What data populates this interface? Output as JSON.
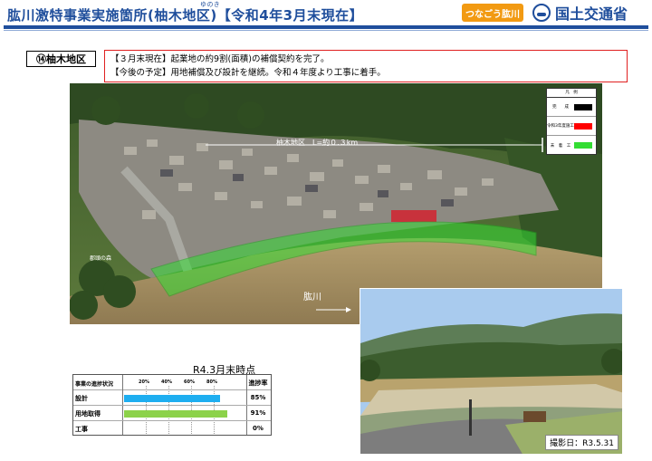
{
  "header": {
    "title": "肱川激特事業実施箇所(柚木地区)【令和4年3月末現在】",
    "ruby": "ゆのき",
    "badge": "つなごう肱川",
    "ministry": "国土交通省"
  },
  "area_label": "⑭柚木地区",
  "status": {
    "line1": "【３月末現在】起業地の約9割(面積)の補償契約を完了。",
    "line2": "【今後の予定】用地補償及び設計を継続。令和４年度より工事に着手。"
  },
  "photo": {
    "district_label": "柚木地区　L=約０.３km",
    "river_label": "肱川",
    "place_label": "郡頭の森",
    "date_label": "撮影日：R3.5.31"
  },
  "legend": {
    "heading": "凡　例",
    "items": [
      {
        "label": "完　　成",
        "color": "#000000"
      },
      {
        "label": "令和3年度施工",
        "color": "#ff0000"
      },
      {
        "label": "未　着　工",
        "color": "#33dd33"
      }
    ]
  },
  "progress": {
    "title": "R4.3月末時点",
    "header_label": "事業の進捗状況",
    "rate_label": "進捗率",
    "ticks": [
      "20%",
      "40%",
      "60%",
      "80%"
    ],
    "rows": [
      {
        "label": "設計",
        "value": 85,
        "pct": "85%",
        "color": "#1eaef0"
      },
      {
        "label": "用地取得",
        "value": 91,
        "pct": "91%",
        "color": "#8cd24a"
      },
      {
        "label": "工事",
        "value": 0,
        "pct": "0%",
        "color": "#1eaef0"
      }
    ]
  }
}
